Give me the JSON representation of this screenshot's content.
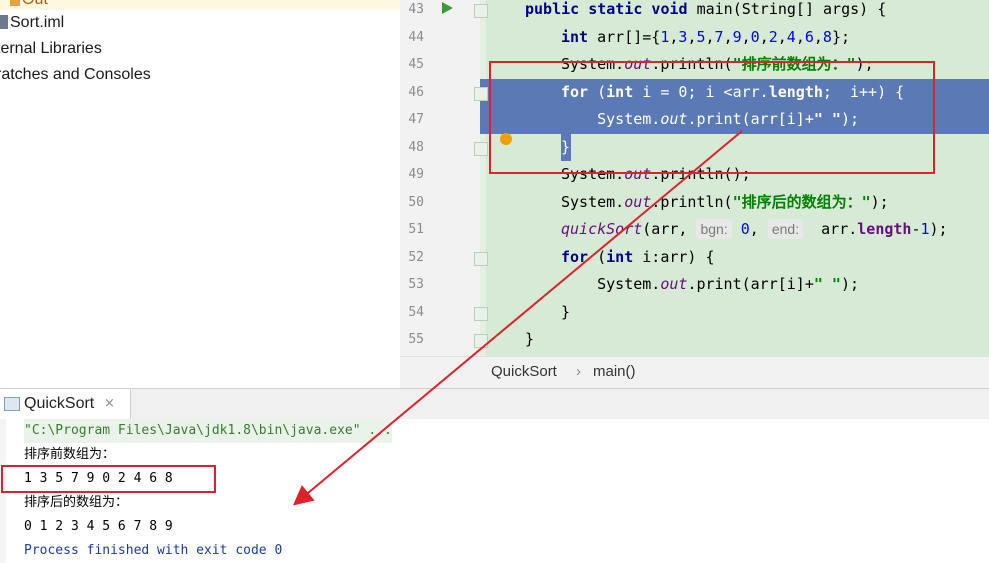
{
  "project_tree": {
    "items": [
      {
        "label": "Out"
      },
      {
        "label": "Sort.iml"
      },
      {
        "label": "ternal Libraries"
      },
      {
        "label": "ratches and Consoles"
      }
    ]
  },
  "editor": {
    "line_numbers": [
      "43",
      "44",
      "45",
      "46",
      "47",
      "48",
      "49",
      "50",
      "51",
      "52",
      "53",
      "54",
      "55"
    ],
    "lines": [
      {
        "t": [
          [
            "kw",
            "public static void "
          ],
          [
            "",
            "main(String[] args) {"
          ]
        ]
      },
      {
        "t": [
          [
            "kw",
            "int "
          ],
          [
            "",
            "arr[]={"
          ],
          [
            "nm",
            "1"
          ],
          [
            "",
            ","
          ],
          [
            "nm",
            "3"
          ],
          [
            "",
            ","
          ],
          [
            "nm",
            "5"
          ],
          [
            "",
            ","
          ],
          [
            "nm",
            "7"
          ],
          [
            "",
            ","
          ],
          [
            "nm",
            "9"
          ],
          [
            "",
            ","
          ],
          [
            "nm",
            "0"
          ],
          [
            "",
            ","
          ],
          [
            "nm",
            "2"
          ],
          [
            "",
            ","
          ],
          [
            "nm",
            "4"
          ],
          [
            "",
            ","
          ],
          [
            "nm",
            "6"
          ],
          [
            "",
            ","
          ],
          [
            "nm",
            "8"
          ],
          [
            "",
            "};"
          ]
        ]
      },
      {
        "t": [
          [
            "",
            "System."
          ],
          [
            "it",
            "out"
          ],
          [
            "",
            ".println("
          ],
          [
            "st",
            "\"排序前数组为：\""
          ],
          [
            "",
            ");"
          ]
        ]
      },
      {
        "t": [
          [
            "kw",
            "for "
          ],
          [
            "",
            "("
          ],
          [
            "kw",
            "int "
          ],
          [
            "",
            "i = "
          ],
          [
            "nm",
            "0"
          ],
          [
            "",
            "; i <arr."
          ],
          [
            "fld",
            "length"
          ],
          [
            "",
            ";  i++) {"
          ]
        ]
      },
      {
        "t": [
          [
            "",
            "    System."
          ],
          [
            "it",
            "out"
          ],
          [
            "",
            ".print(arr[i]+"
          ],
          [
            "st",
            "\" \""
          ],
          [
            "",
            ");"
          ]
        ]
      },
      {
        "t": [
          [
            "",
            "}"
          ]
        ]
      },
      {
        "t": [
          [
            "",
            "System."
          ],
          [
            "it",
            "out"
          ],
          [
            "",
            ".println();"
          ]
        ]
      },
      {
        "t": [
          [
            "",
            "System."
          ],
          [
            "it",
            "out"
          ],
          [
            "",
            ".println("
          ],
          [
            "st",
            "\"排序后的数组为：\""
          ],
          [
            "",
            ");"
          ]
        ]
      },
      {
        "t": [
          [
            "it",
            "quickSort"
          ],
          [
            "",
            "(arr, "
          ],
          [
            "hint",
            "bgn:"
          ],
          [
            "",
            ""
          ],
          [
            "nm",
            " 0"
          ],
          [
            "",
            ", "
          ],
          [
            "hint",
            "end:"
          ],
          [
            "",
            ""
          ],
          [
            "",
            ""
          ],
          [
            "",
            ""
          ],
          [
            "",
            ""
          ],
          [
            "",
            ""
          ],
          [
            "",
            ""
          ],
          [
            "",
            ""
          ],
          [
            "",
            ""
          ],
          [
            "",
            ""
          ],
          [
            "",
            ""
          ],
          [
            "",
            ""
          ],
          [
            "",
            ""
          ],
          [
            "",
            "  arr."
          ],
          [
            "fld",
            "length"
          ],
          [
            "",
            "-"
          ],
          [
            "nm",
            "1"
          ],
          [
            "",
            ");"
          ]
        ]
      },
      {
        "t": [
          [
            "kw",
            "for "
          ],
          [
            "",
            "("
          ],
          [
            "kw",
            "int "
          ],
          [
            "",
            "i:arr) {"
          ]
        ]
      },
      {
        "t": [
          [
            "",
            "    System."
          ],
          [
            "it",
            "out"
          ],
          [
            "",
            ".print(arr[i]+"
          ],
          [
            "st",
            "\" \""
          ],
          [
            "",
            ");"
          ]
        ]
      },
      {
        "t": [
          [
            "",
            "}"
          ]
        ]
      },
      {
        "t": [
          [
            "",
            "}"
          ]
        ]
      }
    ]
  },
  "breadcrumb": {
    "class_name": "QuickSort",
    "separator": "›",
    "method": "main()"
  },
  "run_panel": {
    "tab_label": "QuickSort",
    "close_glyph": "×",
    "console": [
      {
        "text": "\"C:\\Program Files\\Java\\jdk1.8\\bin\\java.exe\" ...",
        "kind": "cmd"
      },
      {
        "text": "排序前数组为：",
        "kind": "out"
      },
      {
        "text": "1 3 5 7 9 0 2 4 6 8",
        "kind": "out"
      },
      {
        "text": "排序后的数组为：",
        "kind": "out"
      },
      {
        "text": "0 1 2 3 4 5 6 7 8 9",
        "kind": "out"
      },
      {
        "text": "Process finished with exit code 0",
        "kind": "exit"
      }
    ]
  },
  "colors": {
    "annotation": "#e0202a",
    "selection": "#5b7ab5",
    "code_bg": "#d6ead6"
  }
}
